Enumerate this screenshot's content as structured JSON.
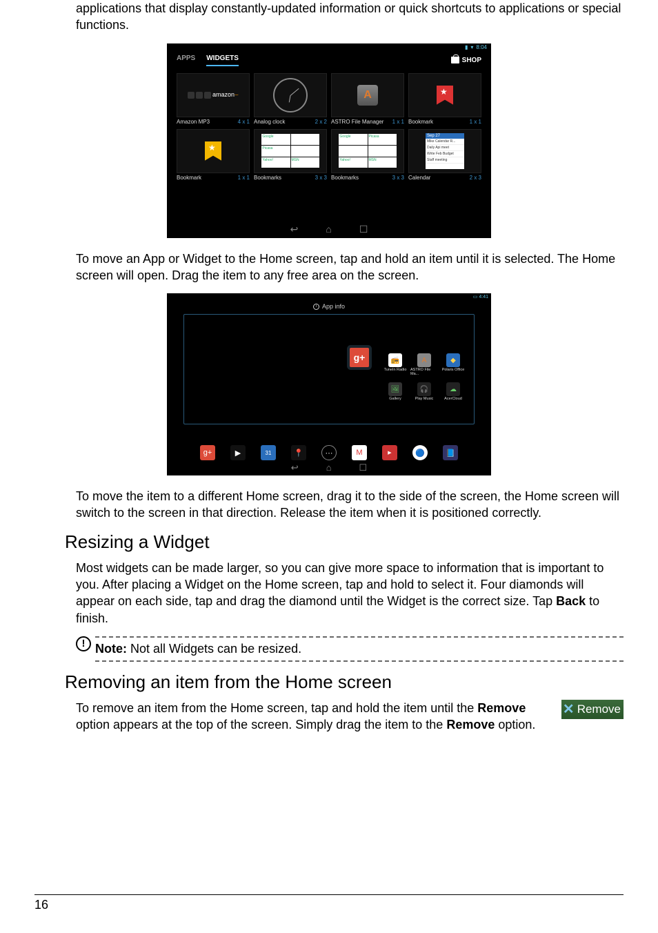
{
  "intro_text": "applications that display constantly-updated information or quick shortcuts to applications or special functions.",
  "shot1": {
    "status_time": "8:04",
    "tabs": {
      "apps": "APPS",
      "widgets": "WIDGETS"
    },
    "shop": "SHOP",
    "widgets": [
      {
        "name": "Amazon MP3",
        "dim": "4 x 1"
      },
      {
        "name": "Analog clock",
        "dim": "2 x 2"
      },
      {
        "name": "ASTRO File Manager",
        "dim": "1 x 1"
      },
      {
        "name": "Bookmark",
        "dim": "1 x 1"
      },
      {
        "name": "Bookmark",
        "dim": "1 x 1"
      },
      {
        "name": "Bookmarks",
        "dim": "3 x 3"
      },
      {
        "name": "Bookmarks",
        "dim": "3 x 3"
      },
      {
        "name": "Calendar",
        "dim": "2 x 3"
      }
    ],
    "calendar_header": "Sep 27",
    "tile_google": "Google",
    "tile_picasa": "Picasa",
    "tile_yahoo": "Yahoo!",
    "tile_msn": "MSN",
    "amazon_label": "amazon"
  },
  "move_text": "To move an App or Widget to the Home screen, tap and hold an item until it is selected. The Home screen will open. Drag the item to any free area on the screen.",
  "shot2": {
    "status_time": "4:41",
    "app_info": "App info",
    "drag_label": "g+",
    "mini": [
      {
        "label": "TuneIn Radio"
      },
      {
        "label": "ASTRO File Ma..."
      },
      {
        "label": "Polaris Office"
      },
      {
        "label": "Gallery"
      },
      {
        "label": "Play Music"
      },
      {
        "label": "AcerCloud"
      }
    ],
    "dock_gplus": "g+"
  },
  "move_side_text": "To move the item to a different Home screen, drag it to the side of the screen, the Home screen will switch to the screen in that direction. Release the item when it is positioned correctly.",
  "resize_heading": "Resizing a Widget",
  "resize_text_pre": "Most widgets can be made larger, so you can give more space to information that is important to you. After placing a Widget on the Home screen, tap and hold to select it. Four diamonds will appear on each side, tap and drag the diamond until the Widget is the correct size. Tap ",
  "resize_text_bold": "Back",
  "resize_text_post": " to finish.",
  "note_icon": "!",
  "note_label": "Note:",
  "note_text": " Not all Widgets can be resized.",
  "remove_heading": "Removing an item from the Home screen",
  "remove_text_1": "To remove an item from the Home screen, tap and hold the item until the ",
  "remove_bold_1": "Remove",
  "remove_text_2": " option appears at the top of the screen. Simply drag the item to the ",
  "remove_bold_2": "Remove",
  "remove_text_3": " option.",
  "remove_pill_x": "✕",
  "remove_pill_label": "Remove",
  "page_number": "16"
}
